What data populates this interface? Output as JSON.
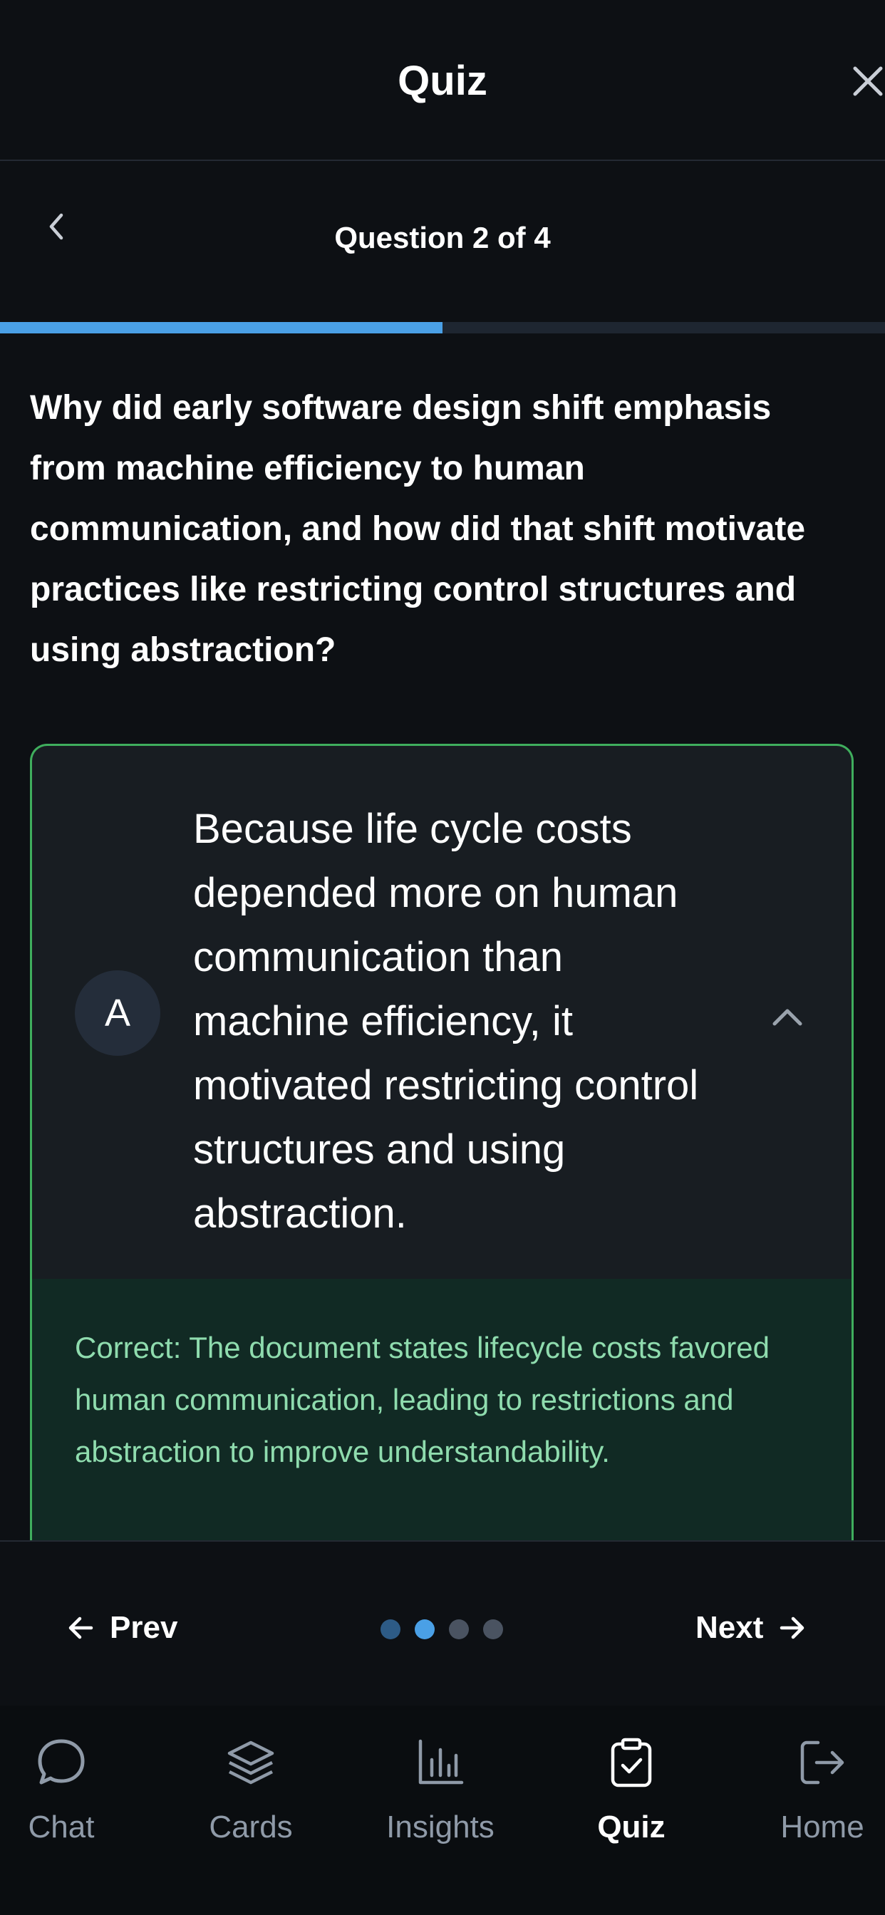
{
  "header": {
    "title": "Quiz"
  },
  "subheader": {
    "counter": "Question 2 of 4"
  },
  "progress": {
    "fraction": 0.5
  },
  "question": {
    "text": "Why did early software design shift emphasis from machine efficiency to human communication, and how did that shift motivate practices like restricting control structures and using abstraction?"
  },
  "answer": {
    "letter": "A",
    "text": "Because life cycle costs depended more on human communication than machine efficiency, it motivated restricting control structures and using abstraction.",
    "feedback": "Correct: The document states lifecycle costs favored human communication, leading to restrictions and abstraction to improve understandability."
  },
  "nav": {
    "prev_label": "Prev",
    "next_label": "Next",
    "dots": [
      {
        "state": "visited"
      },
      {
        "state": "current"
      },
      {
        "state": "upcoming"
      },
      {
        "state": "upcoming"
      }
    ]
  },
  "tabs": [
    {
      "label": "Chat",
      "icon": "chat-bubble-icon",
      "active": false
    },
    {
      "label": "Cards",
      "icon": "layers-icon",
      "active": false
    },
    {
      "label": "Insights",
      "icon": "bar-chart-icon",
      "active": false
    },
    {
      "label": "Quiz",
      "icon": "clipboard-check-icon",
      "active": true
    },
    {
      "label": "Home",
      "icon": "exit-icon",
      "active": false
    }
  ],
  "colors": {
    "accent": "#4aa0e6",
    "correct_border": "#3fae5d",
    "correct_text": "#8fdcae",
    "dot_visited": "#2d5b86",
    "dot_upcoming": "#4a5361"
  }
}
